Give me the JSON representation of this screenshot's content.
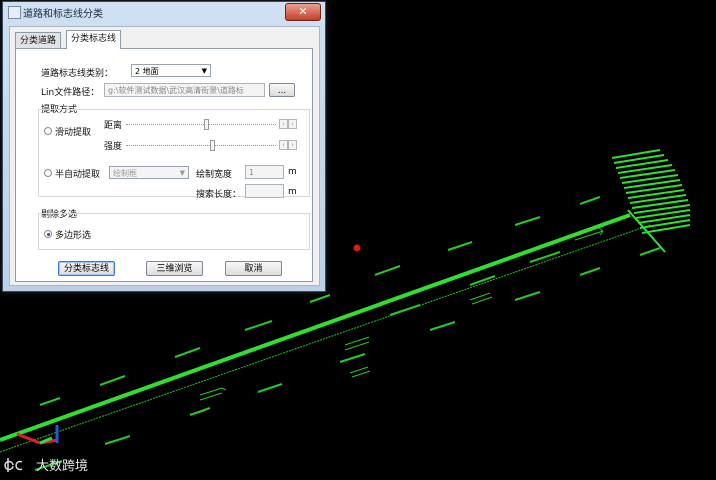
{
  "window": {
    "title": "道路和标志线分类",
    "close_glyph": "✕"
  },
  "tabs": [
    {
      "label": "分类道路"
    },
    {
      "label": "分类标志线"
    }
  ],
  "form": {
    "line_type_label": "道路标志线类别：",
    "line_type_value": "2 地面",
    "lin_path_label": "Lin文件路径：",
    "lin_path_value": "g:\\软件测试数据\\武汉高清街景\\道路标",
    "browse_label": "...",
    "extract_group_label": "提取方式",
    "slide_radio_label": "滑动提取",
    "distance_label": "距离",
    "intensity_label": "强度",
    "semi_auto_radio_label": "半自动提取",
    "draw_shape_value": "绘制框",
    "draw_width_label": "绘制宽度",
    "draw_width_value": "1",
    "unit_m": "m",
    "search_length_label": "搜索长度：",
    "search_length_value": "",
    "remove_group_label": "剔除多选",
    "polygon_radio_label": "多边形选",
    "spin_left": "‹",
    "spin_right": "›"
  },
  "buttons": {
    "classify": "分类标志线",
    "view3d": "三维浏览",
    "cancel": "取消"
  },
  "watermark": "大数跨境",
  "colors": {
    "point_cloud": "#29d629",
    "marker": "#e01818"
  }
}
